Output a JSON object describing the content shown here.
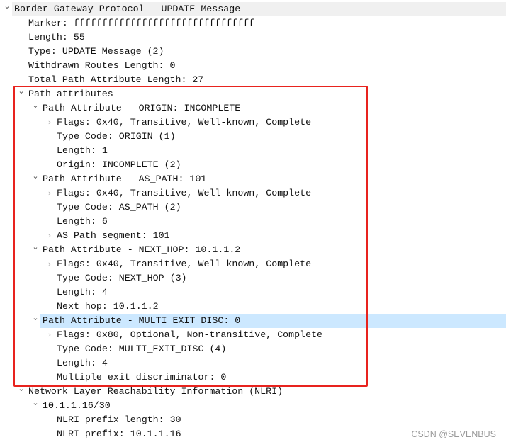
{
  "tree": [
    {
      "level": 0,
      "state": "open",
      "text": "Border Gateway Protocol - UPDATE Message"
    },
    {
      "level": 1,
      "state": "leaf",
      "text": "Marker: ffffffffffffffffffffffffffffffff"
    },
    {
      "level": 1,
      "state": "leaf",
      "text": "Length: 55"
    },
    {
      "level": 1,
      "state": "leaf",
      "text": "Type: UPDATE Message (2)"
    },
    {
      "level": 1,
      "state": "leaf",
      "text": "Withdrawn Routes Length: 0"
    },
    {
      "level": 1,
      "state": "leaf",
      "text": "Total Path Attribute Length: 27"
    },
    {
      "level": 1,
      "state": "open",
      "text": "Path attributes"
    },
    {
      "level": 2,
      "state": "open",
      "text": "Path Attribute - ORIGIN: INCOMPLETE"
    },
    {
      "level": 3,
      "state": "closed",
      "text": "Flags: 0x40, Transitive, Well-known, Complete"
    },
    {
      "level": 3,
      "state": "leaf",
      "text": "Type Code: ORIGIN (1)"
    },
    {
      "level": 3,
      "state": "leaf",
      "text": "Length: 1"
    },
    {
      "level": 3,
      "state": "leaf",
      "text": "Origin: INCOMPLETE (2)"
    },
    {
      "level": 2,
      "state": "open",
      "text": "Path Attribute - AS_PATH: 101"
    },
    {
      "level": 3,
      "state": "closed",
      "text": "Flags: 0x40, Transitive, Well-known, Complete"
    },
    {
      "level": 3,
      "state": "leaf",
      "text": "Type Code: AS_PATH (2)"
    },
    {
      "level": 3,
      "state": "leaf",
      "text": "Length: 6"
    },
    {
      "level": 3,
      "state": "closed",
      "text": "AS Path segment: 101"
    },
    {
      "level": 2,
      "state": "open",
      "text": "Path Attribute - NEXT_HOP: 10.1.1.2"
    },
    {
      "level": 3,
      "state": "closed",
      "text": "Flags: 0x40, Transitive, Well-known, Complete"
    },
    {
      "level": 3,
      "state": "leaf",
      "text": "Type Code: NEXT_HOP (3)"
    },
    {
      "level": 3,
      "state": "leaf",
      "text": "Length: 4"
    },
    {
      "level": 3,
      "state": "leaf",
      "text": "Next hop: 10.1.1.2"
    },
    {
      "level": 2,
      "state": "open",
      "text": "Path Attribute - MULTI_EXIT_DISC: 0",
      "selected": true
    },
    {
      "level": 3,
      "state": "closed",
      "text": "Flags: 0x80, Optional, Non-transitive, Complete"
    },
    {
      "level": 3,
      "state": "leaf",
      "text": "Type Code: MULTI_EXIT_DISC (4)"
    },
    {
      "level": 3,
      "state": "leaf",
      "text": "Length: 4"
    },
    {
      "level": 3,
      "state": "leaf",
      "text": "Multiple exit discriminator: 0"
    },
    {
      "level": 1,
      "state": "open",
      "text": "Network Layer Reachability Information (NLRI)"
    },
    {
      "level": 2,
      "state": "open",
      "text": "10.1.1.16/30"
    },
    {
      "level": 3,
      "state": "leaf",
      "text": "NLRI prefix length: 30"
    },
    {
      "level": 3,
      "state": "leaf",
      "text": "NLRI prefix: 10.1.1.16"
    }
  ],
  "watermark": "CSDN @SEVENBUS",
  "colors": {
    "highlight_box": "#e8231e",
    "selected_row": "#cce8ff"
  }
}
